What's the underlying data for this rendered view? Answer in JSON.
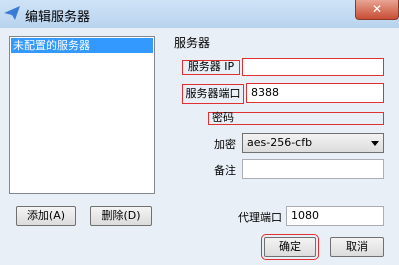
{
  "window": {
    "title": "编辑服务器",
    "close_label": "✕"
  },
  "server_list": {
    "items": [
      "未配置的服务器"
    ]
  },
  "server_group": {
    "label": "服务器"
  },
  "form": {
    "ip_label": "服务器 IP",
    "ip_value": "",
    "port_label": "服务器端口",
    "port_value": "8388",
    "password_label": "密码",
    "password_value": "",
    "encryption_label": "加密",
    "encryption_value": "aes-256-cfb",
    "remark_label": "备注",
    "remark_value": "",
    "proxy_port_label": "代理端口",
    "proxy_port_value": "1080"
  },
  "buttons": {
    "add": "添加(A)",
    "delete": "删除(D)",
    "ok": "确定",
    "cancel": "取消"
  },
  "colors": {
    "highlight": "#e03030",
    "selection": "#3399ff"
  }
}
